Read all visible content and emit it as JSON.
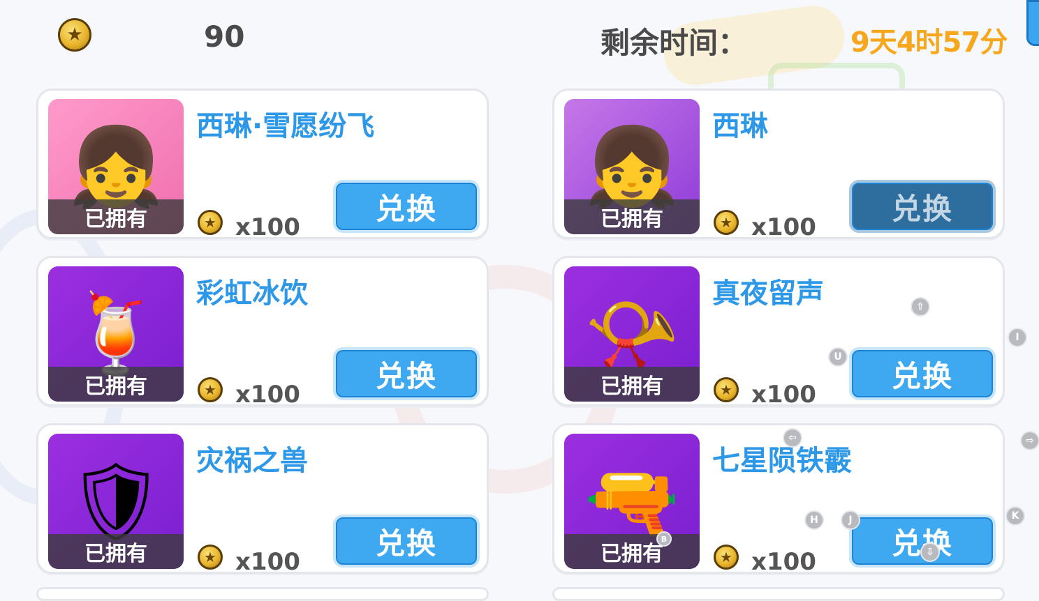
{
  "header": {
    "coin_icon": "gold-star-coin-icon",
    "balance": "90",
    "time_label": "剩余时间：",
    "time_value": "9天4时57分"
  },
  "colors": {
    "accent_blue": "#3ea9f0",
    "name_blue": "#2d97e8",
    "time_orange": "#f6a71d",
    "disabled_blue": "#2d6e9e"
  },
  "items": [
    {
      "name": "西琳·雪愿纷飞",
      "owned": "已拥有",
      "price": "x100",
      "button": "兑换",
      "button_state": "enabled",
      "art_icon": "character-costume-icon"
    },
    {
      "name": "西琳",
      "owned": "已拥有",
      "price": "x100",
      "button": "兑换",
      "button_state": "disabled",
      "art_icon": "character-portrait-icon"
    },
    {
      "name": "彩虹冰饮",
      "owned": "已拥有",
      "price": "x100",
      "button": "兑换",
      "button_state": "enabled",
      "art_icon": "rainbow-drink-icon"
    },
    {
      "name": "真夜留声",
      "owned": "已拥有",
      "price": "x100",
      "button": "兑换",
      "button_state": "enabled",
      "art_icon": "gramophone-icon"
    },
    {
      "name": "灾祸之兽",
      "owned": "已拥有",
      "price": "x100",
      "button": "兑换",
      "button_state": "enabled",
      "art_icon": "beast-emblem-icon"
    },
    {
      "name": "七星陨铁霰",
      "owned": "已拥有",
      "price": "x100",
      "button": "兑换",
      "button_state": "enabled",
      "art_icon": "gun-weapon-icon"
    }
  ],
  "key_hints": {
    "up": "⇧",
    "i": "I",
    "u": "U",
    "left": "⇦",
    "right": "⇨",
    "h": "H",
    "j": "J",
    "k": "K",
    "down": "⇩",
    "b": "B"
  }
}
